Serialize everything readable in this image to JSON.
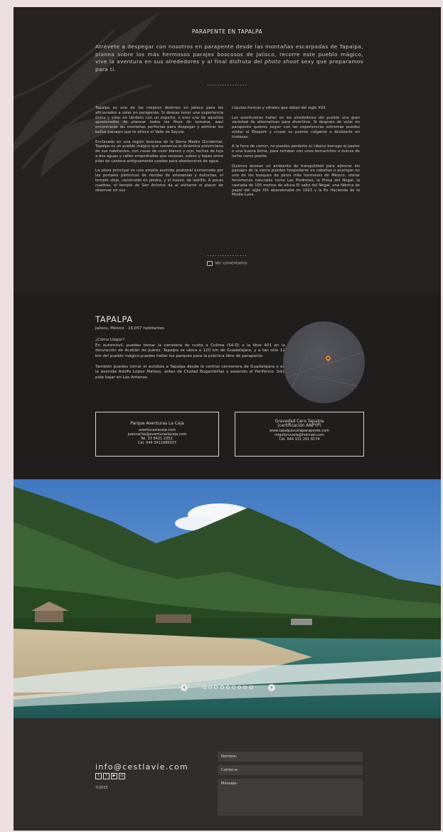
{
  "article": {
    "title": "PARAPENTE EN TAPALPA",
    "intro_main": "Atrévete a despegar con nosotros en parapente desde las montañas escarpadas de Tapalpa, planea sobre los más hermosos parajes boscosos de Jalisco, recorre este pueblo mágico, vive la aventura en sus alrededores y al final disfruta del ",
    "intro_em": "photo shoot",
    "intro_end": " sexy que preparamos para ti.",
    "divider": "................",
    "left_column": [
      "Tapalpa es uno de los mejores destinos en Jalisco para los aficionados a volar en parapente. Si deseas tener una experiencia única y volar en tándem con un experto, o eres uno de aquellos apasionados de planear todos los fines de semana, aquí encontrarás las montañas perfectas para despegar y admirar los bellos paisajes que te ofrece el Valle de Sayula.",
      "Enclavado en una región boscosa de la Sierra Madre Occidental, Tapalpa es un pueblo mágico que conserva la dinámica provinciana de sus habitantes, con casas de color blanco y rojo, techos de teja a dos aguas y calles empedradas que serpean, suben y bajan entre pilas de cantera antiguamente usadas para abastecerse de agua.",
      "La plaza principal es una amplia avenida peatonal enmarcada por los portales pletóricos de tiendas de artesanías y dulcerías, el templo viejo, construido en piedra, y el nuevo, de ladrillo. A pocas cuadras, el templo de San Antonio da al visitante el placer de observar en sus"
    ],
    "right_column": [
      "cúpulas frescos y vitrales que datan del siglo XVII.",
      "Los aventureros hallan en los alrededores del pueblo una gran variedad de alternativas para divertirse. Si después de volar en parapente quieres seguir con las experiencias extremas puedes visitar el Ekopark y cruzar su puente colgante o deslizarte en tirolesas.",
      "A la hora de comer, no puedes perderte el clásico borrego al pastor o una buena birria, para rematar con unos borrachitos o dulces de leche como postre.",
      "Quienes desean un ambiente de tranquilidad para admirar los paisajes de la sierra pueden hospedarse en cabañas o acampar en uno de los bosques de pinos más hermosos de México, visitar fenómenos naturales como Las Piedrotas, la Presa del Nogal, la cascada de 105 metros de altura El salto del Nogal, una fábrica de papel del siglo XIX abandonada en 1923 y la Ex Hacienda de la Media Luna."
    ],
    "comments_label": "Ver comentarios"
  },
  "town": {
    "name": "TAPALPA",
    "subtitle": "Jalisco, México · 16,057 habitantes",
    "how_title": "¿Cómo Llegar?",
    "how_text": "En automóvil, puedes tomar la carretera de cuota a Colima (54-D) o la libre 401 en la desviación de Acatlán de Juárez. Tapalpa se ubica a 120 km de Guadalajara, y a tan sólo 12 km del pueblo mágico puedes hallar los parques para la práctica libre de parapente.",
    "bus_text": "También puedes tomar el autobús a Tapalpa desde la central camionera de Guadalajara o en la avenida Adolfo López Mateos, antes de Ciudad Bugambilias y pasando el Periférico. Sólo pide bajar en Las Antenas.",
    "map_pin_icon": "map-pin-icon",
    "accent": "#e8862c"
  },
  "contacts": [
    {
      "name": "Parque Aventuras La Ceja",
      "subtitle": "",
      "lines": [
        "aventuraslaceja.com",
        "juancarlos@aventuraslaceja.com",
        "Tel. 33 8421 2352.",
        "Cel. 044 3411089337"
      ]
    },
    {
      "name": "Gravedad Cero Tapalpa",
      "subtitle": "(certificación ANPYP)",
      "lines": [
        "www.tapalpavuelaparapente.com",
        "migelonvuela@hotmail.com",
        "Cel. 044 331 201 8174"
      ]
    }
  ],
  "slider": {
    "prev_icon": "chevron-left-icon",
    "next_icon": "chevron-right-icon",
    "dot_count": 9,
    "prev_glyph": "‹",
    "next_glyph": "›"
  },
  "footer": {
    "email": "info@cestlavie.com",
    "social_icons": [
      "twitter-icon",
      "facebook-icon",
      "youtube-icon",
      "instagram-icon"
    ],
    "social_glyphs": [
      "t",
      "f",
      "▶",
      "◎"
    ],
    "copyright": "©2015",
    "form": {
      "name_label": "Nombre:",
      "email_label": "Correo-e:",
      "message_label": "Mensaje:"
    }
  }
}
